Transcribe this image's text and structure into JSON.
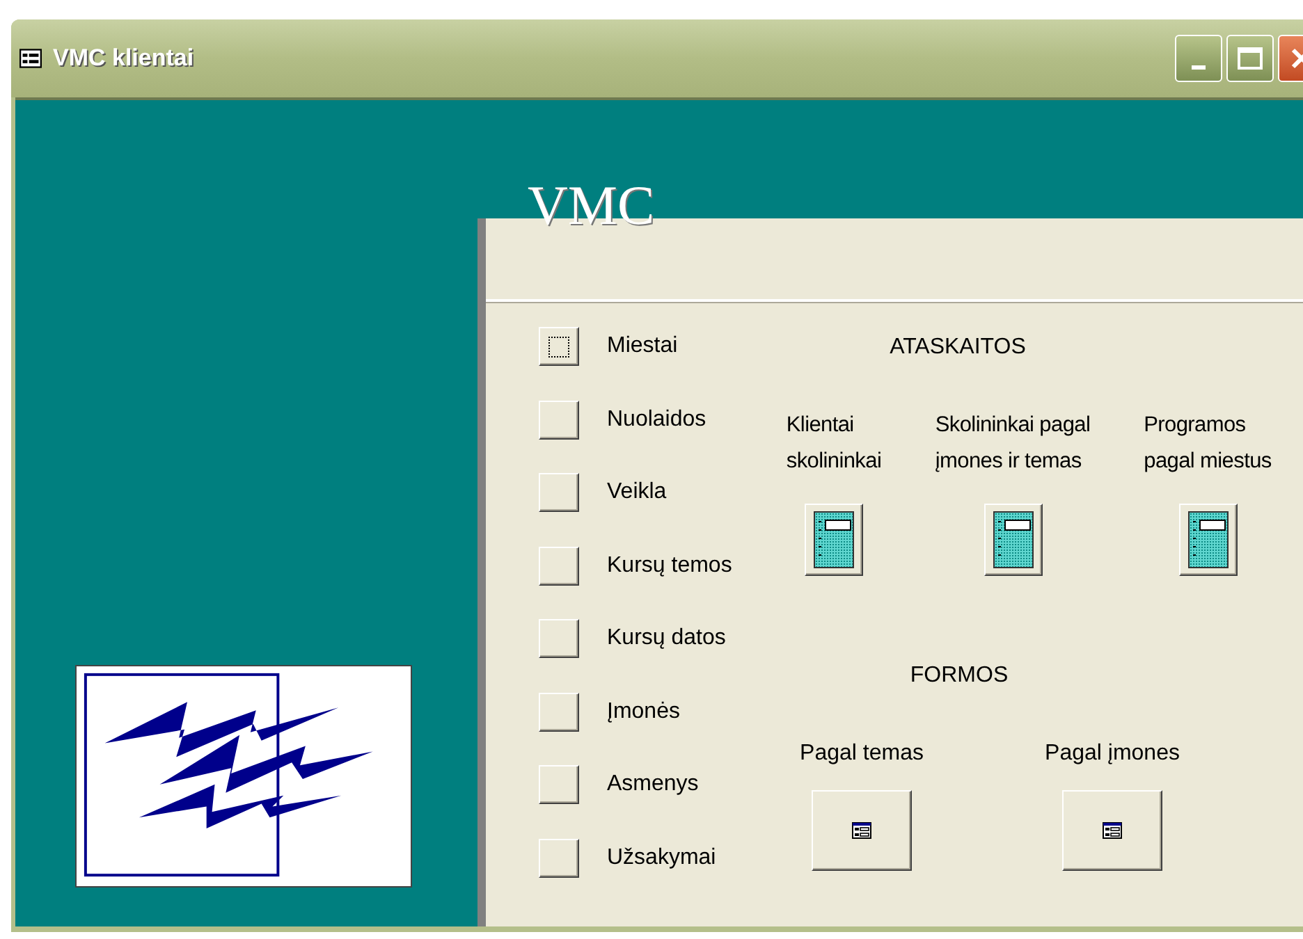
{
  "window": {
    "title": "VMC klientai"
  },
  "header": {
    "title": "VMC"
  },
  "menu_buttons": [
    {
      "label": "Miestai",
      "focused": true
    },
    {
      "label": "Nuolaidos",
      "focused": false
    },
    {
      "label": "Veikla",
      "focused": false
    },
    {
      "label": "Kursų temos",
      "focused": false
    },
    {
      "label": "Kursų datos",
      "focused": false
    },
    {
      "label": "Įmonės",
      "focused": false
    },
    {
      "label": "Asmenys",
      "focused": false
    },
    {
      "label": "Užsakymai",
      "focused": false
    }
  ],
  "reports": {
    "heading": "ATASKAITOS",
    "items": [
      {
        "label": "Klientai\nskolininkai"
      },
      {
        "label": "Skolininkai pagal\nįmones ir temas"
      },
      {
        "label": "Programos\npagal miestus"
      }
    ]
  },
  "forms": {
    "heading": "FORMOS",
    "items": [
      {
        "label": "Pagal temas"
      },
      {
        "label": "Pagal įmones"
      }
    ]
  }
}
